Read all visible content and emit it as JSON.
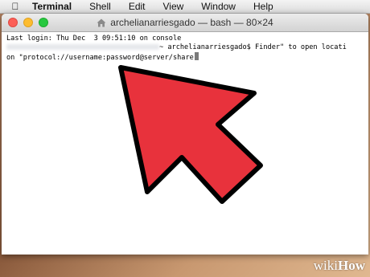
{
  "menubar": {
    "apple_icon": "apple-logo-icon",
    "items": [
      "Terminal",
      "Shell",
      "Edit",
      "View",
      "Window",
      "Help"
    ]
  },
  "window": {
    "title": "archelianarriesgado — bash — 80×24",
    "title_icon": "home-folder-icon",
    "lines": [
      "Last login: Thu Dec  3 09:51:10 on console",
      "~ archelianarriesgado$ Finder\" to open locati",
      "on \"protocol://username:password@server/share"
    ]
  },
  "overlay": {
    "arrow_color": "#e8323c",
    "arrow_outline": "#000000"
  },
  "watermark": {
    "prefix": "wiki",
    "suffix": "How"
  }
}
